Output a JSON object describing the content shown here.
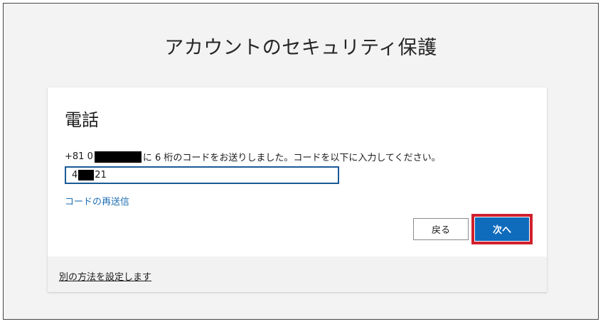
{
  "page": {
    "title": "アカウントのセキュリティ保護"
  },
  "card": {
    "heading": "電話",
    "instruction_prefix": "+81 0",
    "instruction_suffix": "に 6 桁のコードをお送りしました。コードを以下に入力してください。",
    "code_input": {
      "value_prefix": "4",
      "value_suffix": "21"
    },
    "resend_link": "コードの再送信",
    "buttons": {
      "back_label": "戻る",
      "next_label": "次へ"
    },
    "footer": {
      "alt_method_link": "別の方法を設定します"
    }
  },
  "colors": {
    "primary": "#0f6cbd",
    "highlight": "#d0202c",
    "link": "#1f6fb3",
    "input_border": "#1a5a96"
  }
}
